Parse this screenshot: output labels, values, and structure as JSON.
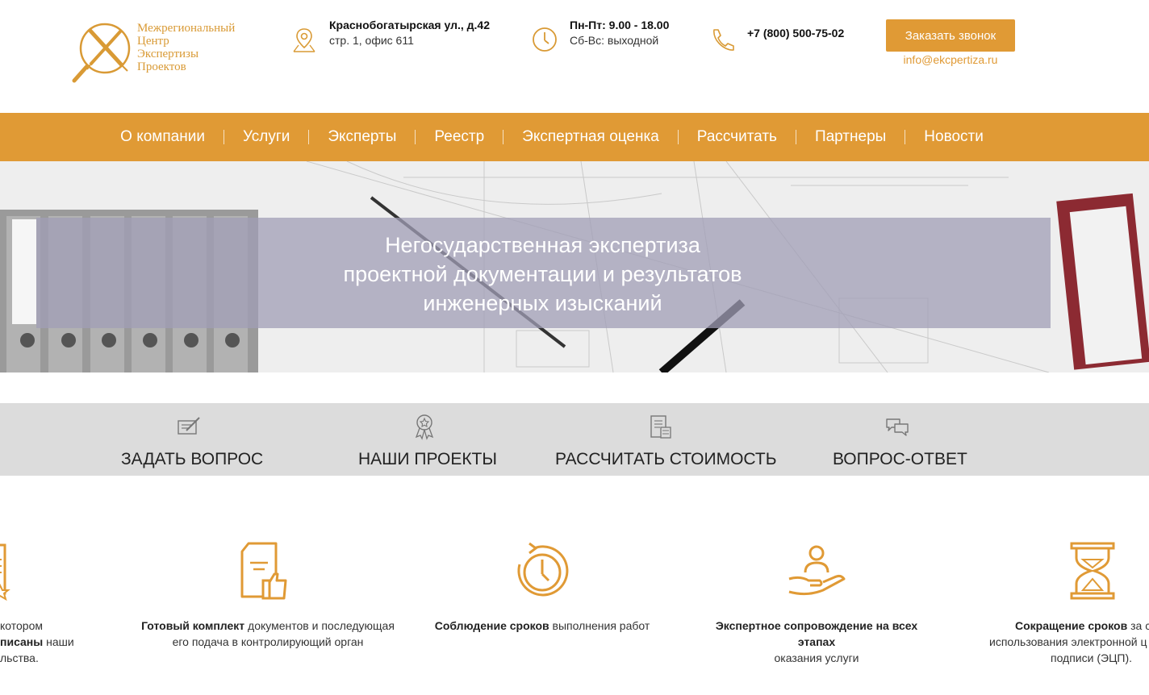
{
  "header": {
    "logo_lines": [
      "Межрегиональный",
      "Центр",
      "Экспертизы",
      "Проектов"
    ],
    "address_line1": "Краснобогатырская ул., д.42",
    "address_line2": "стр. 1, офис 611",
    "hours_line1": "Пн-Пт: 9.00 - 18.00",
    "hours_line2": "Сб-Вс: выходной",
    "phone": "+7 (800) 500-75-02",
    "callback_label": "Заказать звонок",
    "email": "info@ekcpertiza.ru"
  },
  "nav": {
    "items": [
      "О компании",
      "Услуги",
      "Эксперты",
      "Реестр",
      "Экспертная оценка",
      "Рассчитать",
      "Партнеры",
      "Новости"
    ]
  },
  "hero": {
    "lines": [
      "Негосударственная экспертиза",
      "проектной документации и результатов",
      "инженерных изысканий"
    ]
  },
  "quick_links": [
    {
      "label": "ЗАДАТЬ ВОПРОС",
      "icon": "pencil-letter-icon"
    },
    {
      "label": "НАШИ ПРОЕКТЫ",
      "icon": "award-icon"
    },
    {
      "label": "РАССЧИТАТЬ СТОИМОСТЬ",
      "icon": "calculator-document-icon"
    },
    {
      "label": "ВОПРОС-ОТВЕТ",
      "icon": "chat-bubbles-icon"
    }
  ],
  "features": [
    {
      "pre": "котором",
      "bold": "писаны",
      "post": " наши",
      "tail": "льства."
    },
    {
      "bold": "Готовый комплект",
      "post": " документов и последующая его подача в контролирующий орган"
    },
    {
      "bold": "Соблюдение сроков",
      "post": " выполнения работ"
    },
    {
      "bold": "Экспертное сопровождение на всех этапах",
      "post": "оказания услуги"
    },
    {
      "bold": "Сокращение сроков",
      "post": " за с",
      "l2": "использования электронной ц",
      "l3": "подписи (ЭЦП)."
    }
  ],
  "colors": {
    "accent": "#e09a35",
    "banner": "#a09eb6",
    "quickbar": "#dcdcdc"
  }
}
